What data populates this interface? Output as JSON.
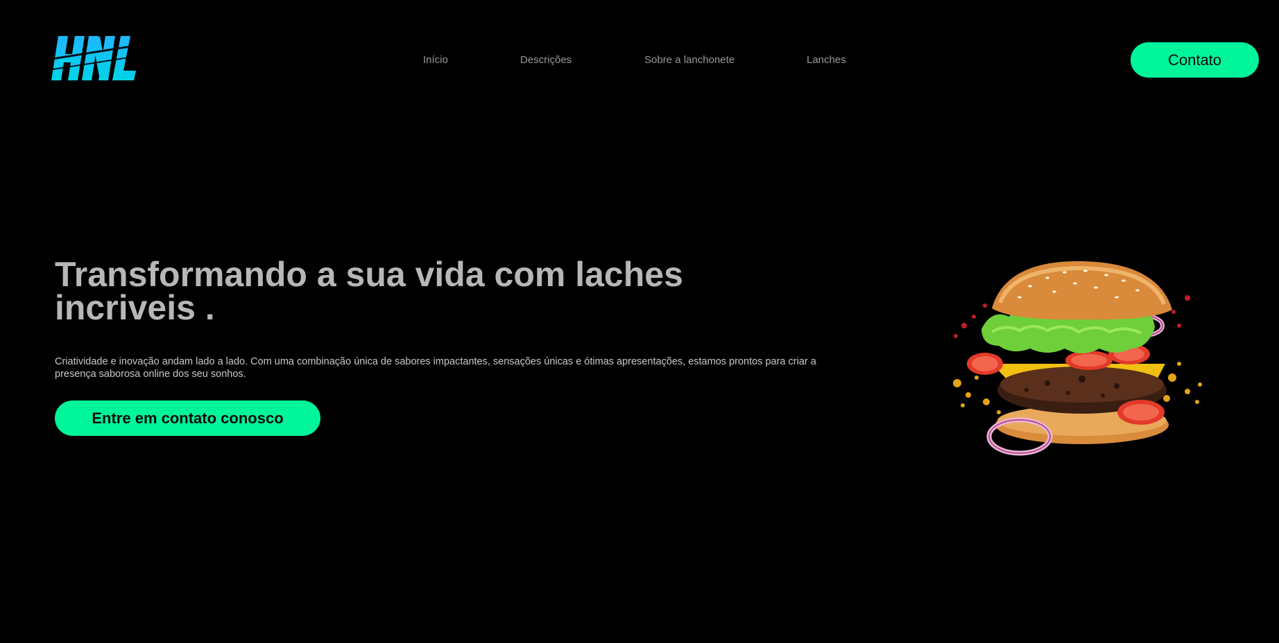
{
  "logo": {
    "text": "HNL",
    "color_top": "#1fb8ff",
    "color_bottom": "#00d4e6"
  },
  "nav": {
    "items": [
      {
        "label": "Início"
      },
      {
        "label": "Descrições"
      },
      {
        "label": "Sobre a lanchonete"
      },
      {
        "label": "Lanches"
      }
    ]
  },
  "header": {
    "contact_label": "Contato"
  },
  "hero": {
    "title": "Transformando a sua vida com laches incriveis .",
    "description": "Criatividade e inovação andam lado a lado. Com uma combinação única de sabores impactantes, sensações únicas e ótimas apresentações, estamos prontos para criar a presença saborosa online dos seu sonhos.",
    "cta_label": "Entre em contato conosco",
    "image": "burger-image"
  },
  "colors": {
    "background": "#000000",
    "accent": "#00f59b",
    "nav_text": "#9a9a9a",
    "title_text": "#b7b7b7"
  }
}
